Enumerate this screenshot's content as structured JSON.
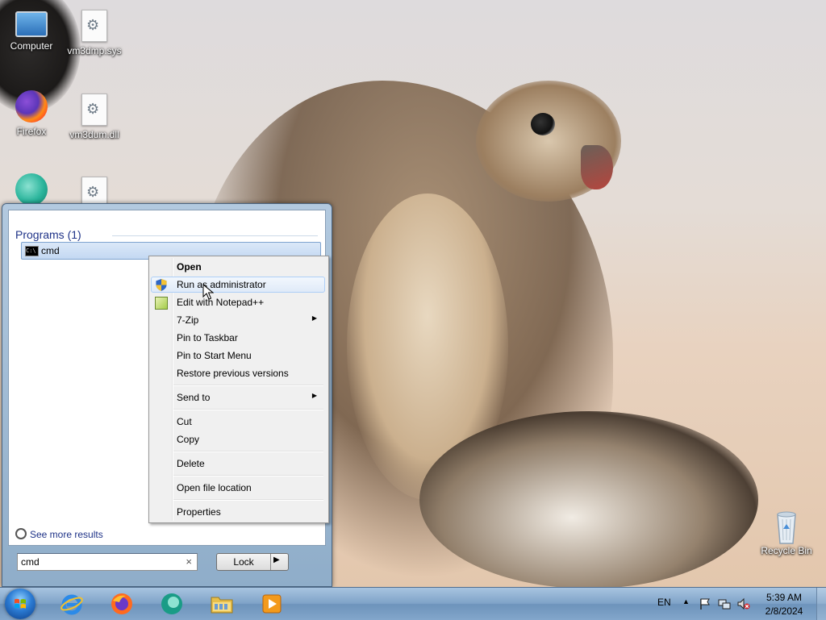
{
  "desktop": {
    "icons": [
      {
        "label": "Computer",
        "icon": "computer-icon"
      },
      {
        "label": "vm3dmp.sys",
        "icon": "system-file-icon"
      },
      {
        "label": "Firefox",
        "icon": "firefox-icon"
      },
      {
        "label": "vm3dum.dll",
        "icon": "dll-file-icon"
      },
      {
        "label": "",
        "icon": "app-icon"
      },
      {
        "label": "",
        "icon": "system-file-icon"
      },
      {
        "label": "Recycle Bin",
        "icon": "recycle-bin-icon"
      }
    ]
  },
  "start_menu": {
    "section_title": "Programs (1)",
    "result_label": "cmd",
    "see_more": "See more results",
    "search_value": "cmd",
    "clear_glyph": "×",
    "power_button": "Lock",
    "power_arrow": "▶"
  },
  "context_menu": {
    "items": [
      {
        "label": "Open",
        "bold": true
      },
      {
        "label": "Run as administrator",
        "icon": "uac-shield-icon",
        "highlighted": true
      },
      {
        "label": "Edit with Notepad++",
        "icon": "notepad-plus-plus-icon"
      },
      {
        "label": "7-Zip",
        "submenu": true
      },
      {
        "label": "Pin to Taskbar"
      },
      {
        "label": "Pin to Start Menu"
      },
      {
        "label": "Restore previous versions"
      },
      {
        "label": "Send to",
        "submenu": true
      },
      {
        "label": "Cut"
      },
      {
        "label": "Copy"
      },
      {
        "label": "Delete"
      },
      {
        "label": "Open file location"
      },
      {
        "label": "Properties"
      }
    ],
    "submenu_arrow": "▶"
  },
  "taskbar": {
    "pinned": [
      "internet-explorer-icon",
      "firefox-icon",
      "app-icon",
      "file-explorer-icon",
      "media-player-icon"
    ],
    "language": "EN",
    "show_hidden": "▲",
    "time": "5:39 AM",
    "date": "2/8/2024"
  }
}
